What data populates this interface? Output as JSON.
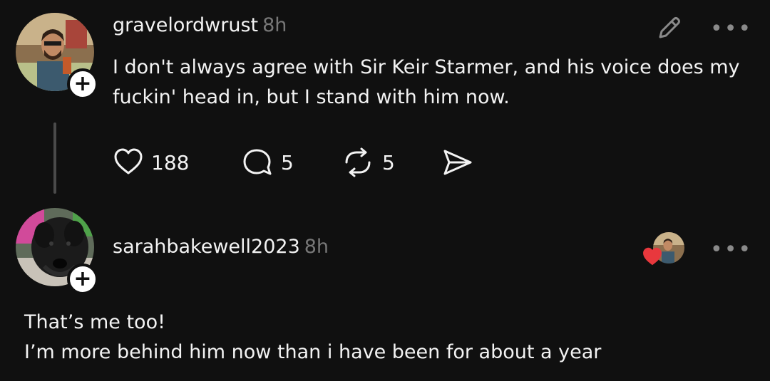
{
  "post": {
    "username": "gravelordwrust",
    "time": "8h",
    "text_line1": "I don't always agree with Sir Keir Starmer, and his voice does my",
    "text_line2": "fuckin' head in, but I stand with him now.",
    "likes": "188",
    "replies": "5",
    "reposts": "5",
    "more_label": "•••"
  },
  "reply": {
    "username": "sarahbakewell2023",
    "time": "8h",
    "text_line1": "That’s me too!",
    "text_line2": "I’m more behind him now than i have been for about a year",
    "more_label": "•••"
  },
  "follow_label": "+",
  "colors": {
    "background": "#101010",
    "text": "#f3f3f3",
    "muted": "#777777",
    "heart": "#e8383d"
  },
  "icons": [
    "heart-icon",
    "comment-icon",
    "repost-icon",
    "share-icon",
    "edit-icon",
    "more-icon"
  ]
}
